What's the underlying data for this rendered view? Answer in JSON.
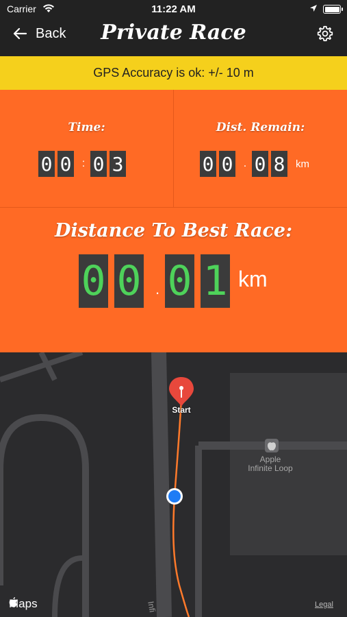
{
  "status_bar": {
    "carrier": "Carrier",
    "time": "11:22 AM"
  },
  "nav": {
    "back_label": "Back",
    "title": "Private Race"
  },
  "gps_banner": {
    "text": "GPS Accuracy is ok: +/- 10 m",
    "color": "#f5d01c"
  },
  "stats": {
    "time": {
      "label": "Time:",
      "digits": [
        "0",
        "0",
        "0",
        "3"
      ],
      "separator": ":"
    },
    "dist_remain": {
      "label": "Dist. Remain:",
      "digits": [
        "0",
        "0",
        "0",
        "8"
      ],
      "separator": ".",
      "unit": "km"
    },
    "best_race": {
      "label": "Distance To Best Race:",
      "digits": [
        "0",
        "0",
        "0",
        "1"
      ],
      "separator": ".",
      "unit": "km"
    }
  },
  "map": {
    "start_label": "Start",
    "poi_line1": "Apple",
    "poi_line2": "Infinite Loop",
    "street_label": "Infi",
    "brand": "Maps",
    "legal": "Legal"
  },
  "colors": {
    "panel": "#ff6a25",
    "header": "#222222",
    "digit_green": "#4ed25a",
    "route": "#ff7a2b",
    "location_dot": "#1f7cf5",
    "pin": "#e8483c"
  },
  "icons": [
    "wifi-icon",
    "location-arrow-icon",
    "battery-icon",
    "back-arrow-icon",
    "gear-icon",
    "poi-apple-icon",
    "apple-logo-icon",
    "map-pin-icon",
    "user-location-icon"
  ]
}
